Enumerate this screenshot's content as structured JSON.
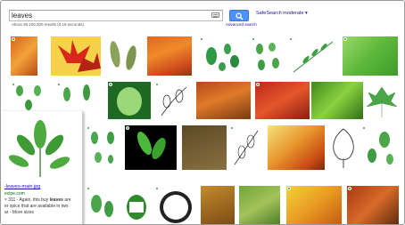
{
  "search": {
    "query": "leaves",
    "button_label": ""
  },
  "safesearch_label": "SafeSearch moderate ▾",
  "results_count": "About 39,100,000 results (0.18 seconds)",
  "advanced_search": "Advanced search",
  "preview": {
    "link": "-leaves-main.jpg",
    "domain": "ecipe.com",
    "snippet_prefix": "× 311 - Again, this buy ",
    "snippet_bold": "leaves",
    "snippet_suffix": " are",
    "snippet_line2": "er spice that are available in two",
    "snippet_line3": "ar - More sizes"
  },
  "colors": {
    "accent": "#4d90fe",
    "link": "#1a0dab",
    "url_green": "#006621",
    "check_green": "#3b9a3b"
  }
}
